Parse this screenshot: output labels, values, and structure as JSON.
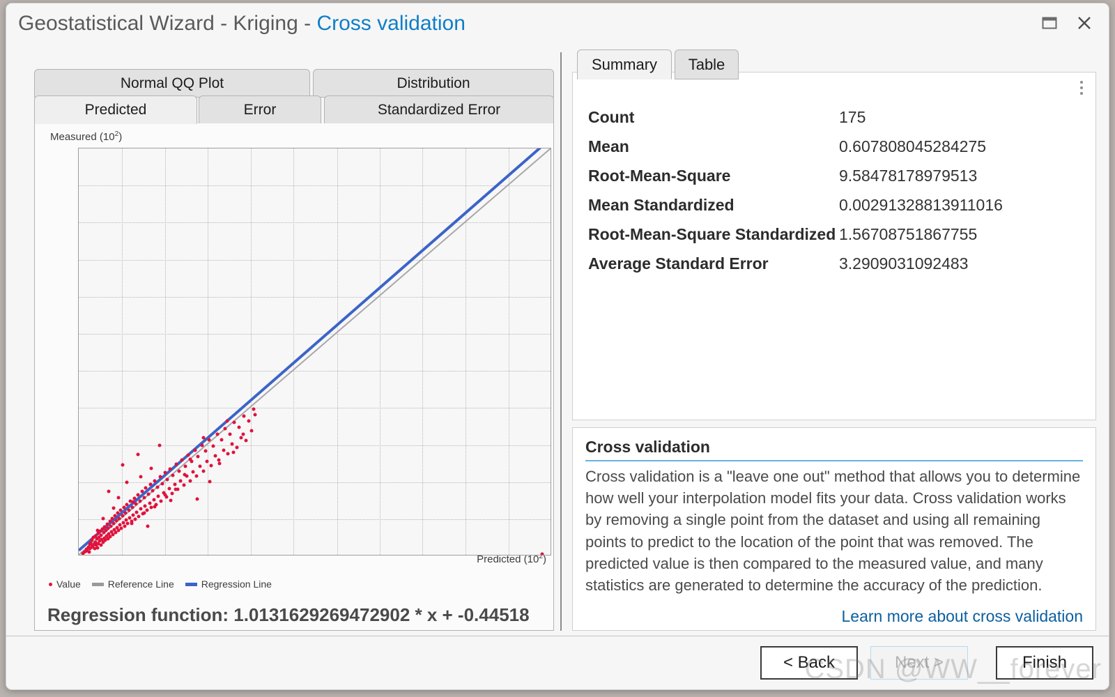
{
  "window": {
    "title_prefix": "Geostatistical Wizard - Kriging",
    "title_dash": " - ",
    "title_accent": "Cross validation",
    "restore_icon": "restore-icon",
    "close_icon": "close-icon"
  },
  "accent_color": "#0f7ec8",
  "left_panel": {
    "tabs_top": [
      {
        "label": "Normal QQ Plot",
        "active": false
      },
      {
        "label": "Distribution",
        "active": false
      }
    ],
    "tabs_bottom": [
      {
        "label": "Predicted",
        "active": true
      },
      {
        "label": "Error",
        "active": false
      },
      {
        "label": "Standardized Error",
        "active": false
      }
    ],
    "regression_text": "Regression function: 1.0131629269472902 * x + -0.44518"
  },
  "chart_data": {
    "type": "scatter",
    "title": "",
    "xlabel": "Predicted (10²)",
    "ylabel": "Measured (10²)",
    "xlabel_base": "Predicted (10",
    "xlabel_exp": "2",
    "ylabel_base": "Measured (10",
    "ylabel_exp": "2",
    "grid": true,
    "xlim": [
      0.071,
      1.275
    ],
    "ylim": [
      0.071,
      1.275
    ],
    "xticks": [
      "0.071",
      "0.181",
      "0.29",
      "0.399",
      "0.509",
      "0.618",
      "0.728",
      "0.837",
      "0.946",
      "1.056",
      "1.165",
      "1.275"
    ],
    "yticks": [
      "1.275",
      "1.165",
      "1.056",
      "0.946",
      "0.837",
      "0.728",
      "0.618",
      "0.509",
      "0.399",
      "0.29",
      "0.181",
      "0.071"
    ],
    "legend_position": "bottom-left",
    "legend": [
      {
        "label": "Value",
        "marker": "dot",
        "color": "#e0123c"
      },
      {
        "label": "Reference Line",
        "marker": "line",
        "color": "#9a9a9a"
      },
      {
        "label": "Regression Line",
        "marker": "line",
        "color": "#3c64c8"
      }
    ],
    "reference_line": {
      "slope": 1,
      "intercept": 0,
      "color": "#9a9a9a"
    },
    "regression_line": {
      "slope": 1.0131629269472902,
      "intercept": -0.44518,
      "color": "#3c64c8"
    },
    "points": [
      [
        0.082,
        0.079
      ],
      [
        0.085,
        0.083
      ],
      [
        0.088,
        0.086
      ],
      [
        0.09,
        0.092
      ],
      [
        0.093,
        0.088
      ],
      [
        0.095,
        0.098
      ],
      [
        0.097,
        0.084
      ],
      [
        0.099,
        0.105
      ],
      [
        0.1,
        0.093
      ],
      [
        0.102,
        0.11
      ],
      [
        0.104,
        0.097
      ],
      [
        0.105,
        0.118
      ],
      [
        0.107,
        0.101
      ],
      [
        0.108,
        0.126
      ],
      [
        0.11,
        0.106
      ],
      [
        0.111,
        0.094
      ],
      [
        0.113,
        0.113
      ],
      [
        0.114,
        0.131
      ],
      [
        0.116,
        0.104
      ],
      [
        0.117,
        0.122
      ],
      [
        0.119,
        0.096
      ],
      [
        0.12,
        0.138
      ],
      [
        0.121,
        0.109
      ],
      [
        0.123,
        0.127
      ],
      [
        0.124,
        0.116
      ],
      [
        0.126,
        0.145
      ],
      [
        0.127,
        0.103
      ],
      [
        0.128,
        0.133
      ],
      [
        0.13,
        0.12
      ],
      [
        0.131,
        0.152
      ],
      [
        0.133,
        0.112
      ],
      [
        0.134,
        0.141
      ],
      [
        0.136,
        0.125
      ],
      [
        0.137,
        0.158
      ],
      [
        0.139,
        0.118
      ],
      [
        0.14,
        0.147
      ],
      [
        0.142,
        0.131
      ],
      [
        0.143,
        0.166
      ],
      [
        0.145,
        0.123
      ],
      [
        0.146,
        0.153
      ],
      [
        0.148,
        0.137
      ],
      [
        0.15,
        0.174
      ],
      [
        0.151,
        0.129
      ],
      [
        0.153,
        0.16
      ],
      [
        0.155,
        0.143
      ],
      [
        0.156,
        0.182
      ],
      [
        0.158,
        0.134
      ],
      [
        0.16,
        0.168
      ],
      [
        0.162,
        0.15
      ],
      [
        0.163,
        0.19
      ],
      [
        0.165,
        0.141
      ],
      [
        0.167,
        0.175
      ],
      [
        0.169,
        0.156
      ],
      [
        0.17,
        0.198
      ],
      [
        0.172,
        0.147
      ],
      [
        0.174,
        0.183
      ],
      [
        0.176,
        0.163
      ],
      [
        0.178,
        0.206
      ],
      [
        0.18,
        0.153
      ],
      [
        0.182,
        0.191
      ],
      [
        0.184,
        0.17
      ],
      [
        0.186,
        0.215
      ],
      [
        0.188,
        0.16
      ],
      [
        0.19,
        0.199
      ],
      [
        0.192,
        0.177
      ],
      [
        0.194,
        0.224
      ],
      [
        0.196,
        0.167
      ],
      [
        0.198,
        0.207
      ],
      [
        0.2,
        0.185
      ],
      [
        0.203,
        0.233
      ],
      [
        0.205,
        0.174
      ],
      [
        0.207,
        0.216
      ],
      [
        0.21,
        0.193
      ],
      [
        0.212,
        0.242
      ],
      [
        0.214,
        0.181
      ],
      [
        0.217,
        0.225
      ],
      [
        0.219,
        0.201
      ],
      [
        0.222,
        0.252
      ],
      [
        0.224,
        0.189
      ],
      [
        0.227,
        0.234
      ],
      [
        0.229,
        0.21
      ],
      [
        0.232,
        0.262
      ],
      [
        0.234,
        0.197
      ],
      [
        0.237,
        0.244
      ],
      [
        0.24,
        0.219
      ],
      [
        0.242,
        0.272
      ],
      [
        0.245,
        0.206
      ],
      [
        0.248,
        0.254
      ],
      [
        0.251,
        0.228
      ],
      [
        0.254,
        0.283
      ],
      [
        0.256,
        0.215
      ],
      [
        0.259,
        0.264
      ],
      [
        0.262,
        0.238
      ],
      [
        0.265,
        0.294
      ],
      [
        0.268,
        0.224
      ],
      [
        0.271,
        0.275
      ],
      [
        0.274,
        0.248
      ],
      [
        0.278,
        0.305
      ],
      [
        0.281,
        0.234
      ],
      [
        0.284,
        0.286
      ],
      [
        0.287,
        0.259
      ],
      [
        0.291,
        0.317
      ],
      [
        0.294,
        0.245
      ],
      [
        0.297,
        0.298
      ],
      [
        0.301,
        0.27
      ],
      [
        0.304,
        0.329
      ],
      [
        0.308,
        0.256
      ],
      [
        0.311,
        0.31
      ],
      [
        0.315,
        0.282
      ],
      [
        0.319,
        0.342
      ],
      [
        0.322,
        0.268
      ],
      [
        0.326,
        0.323
      ],
      [
        0.33,
        0.294
      ],
      [
        0.334,
        0.355
      ],
      [
        0.338,
        0.281
      ],
      [
        0.342,
        0.337
      ],
      [
        0.346,
        0.307
      ],
      [
        0.35,
        0.369
      ],
      [
        0.354,
        0.294
      ],
      [
        0.358,
        0.351
      ],
      [
        0.362,
        0.321
      ],
      [
        0.367,
        0.384
      ],
      [
        0.371,
        0.308
      ],
      [
        0.375,
        0.366
      ],
      [
        0.38,
        0.336
      ],
      [
        0.384,
        0.399
      ],
      [
        0.389,
        0.323
      ],
      [
        0.394,
        0.381
      ],
      [
        0.398,
        0.351
      ],
      [
        0.403,
        0.415
      ],
      [
        0.408,
        0.339
      ],
      [
        0.413,
        0.397
      ],
      [
        0.418,
        0.367
      ],
      [
        0.423,
        0.431
      ],
      [
        0.428,
        0.356
      ],
      [
        0.434,
        0.414
      ],
      [
        0.439,
        0.384
      ],
      [
        0.444,
        0.448
      ],
      [
        0.45,
        0.374
      ],
      [
        0.455,
        0.432
      ],
      [
        0.461,
        0.402
      ],
      [
        0.467,
        0.466
      ],
      [
        0.473,
        0.393
      ],
      [
        0.479,
        0.451
      ],
      [
        0.485,
        0.421
      ],
      [
        0.491,
        0.485
      ],
      [
        0.497,
        0.413
      ],
      [
        0.503,
        0.471
      ],
      [
        0.51,
        0.441
      ],
      [
        0.516,
        0.505
      ],
      [
        0.148,
        0.262
      ],
      [
        0.172,
        0.244
      ],
      [
        0.193,
        0.289
      ],
      [
        0.21,
        0.232
      ],
      [
        0.228,
        0.305
      ],
      [
        0.16,
        0.212
      ],
      [
        0.238,
        0.198
      ],
      [
        0.255,
        0.33
      ],
      [
        0.182,
        0.34
      ],
      [
        0.265,
        0.218
      ],
      [
        0.29,
        0.252
      ],
      [
        0.222,
        0.372
      ],
      [
        0.305,
        0.235
      ],
      [
        0.133,
        0.182
      ],
      [
        0.205,
        0.168
      ],
      [
        0.246,
        0.16
      ],
      [
        0.318,
        0.268
      ],
      [
        0.276,
        0.398
      ],
      [
        0.34,
        0.312
      ],
      [
        0.355,
        0.358
      ],
      [
        0.372,
        0.24
      ],
      [
        0.388,
        0.42
      ],
      [
        0.404,
        0.292
      ],
      [
        0.118,
        0.148
      ],
      [
        0.43,
        0.345
      ],
      [
        0.448,
        0.47
      ],
      [
        0.465,
        0.378
      ],
      [
        0.49,
        0.432
      ],
      [
        0.52,
        0.488
      ],
      [
        1.25,
        0.078
      ]
    ]
  },
  "right_panel": {
    "tabs": [
      {
        "label": "Summary",
        "active": true
      },
      {
        "label": "Table",
        "active": false
      }
    ],
    "kebab_icon": "kebab-menu-icon",
    "stats": [
      {
        "label": "Count",
        "value": "175"
      },
      {
        "label": "Mean",
        "value": "0.607808045284275"
      },
      {
        "label": "Root-Mean-Square",
        "value": "9.58478178979513"
      },
      {
        "label": "Mean Standardized",
        "value": "0.00291328813911016"
      },
      {
        "label": "Root-Mean-Square Standardized",
        "value": "1.56708751867755"
      },
      {
        "label": "Average Standard Error",
        "value": "3.2909031092483"
      }
    ],
    "description": {
      "title": "Cross validation",
      "body": "Cross validation is a \"leave one out\" method that allows you to determine how well your interpolation model fits your data. Cross validation works by removing a single point from the dataset and using all remaining points to predict to the location of the point that was removed. The predicted value is then compared to the measured value, and many statistics are generated to determine the accuracy of the prediction.",
      "link": "Learn more about cross validation"
    }
  },
  "footer": {
    "back_label": "< Back",
    "next_label": "Next >",
    "finish_label": "Finish"
  },
  "watermark": "CSDN @WW__forever"
}
